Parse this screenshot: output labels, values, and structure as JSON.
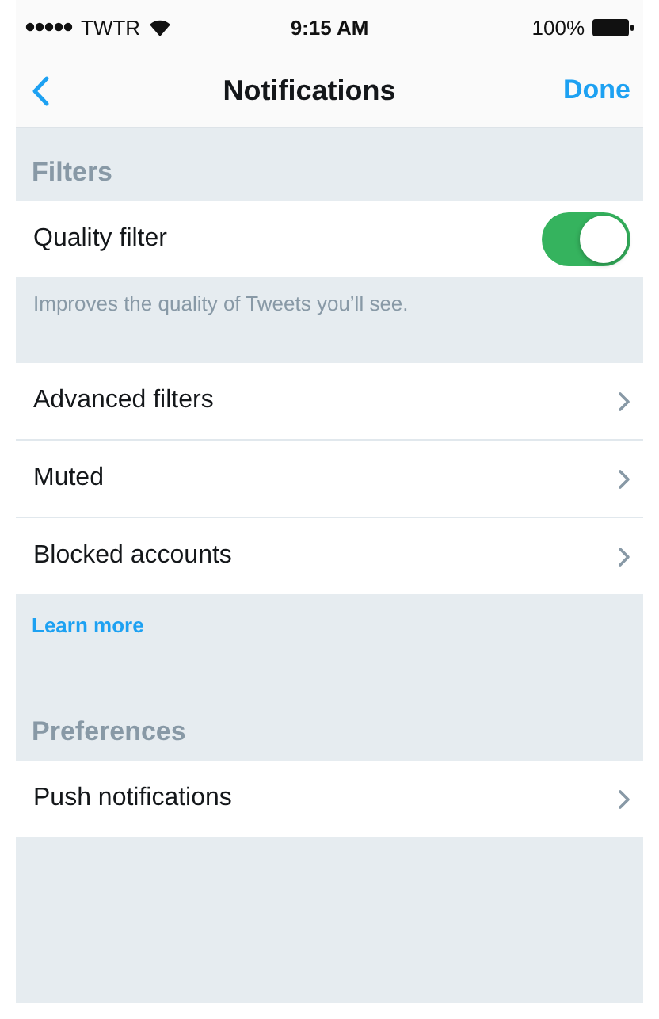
{
  "status_bar": {
    "carrier": "TWTR",
    "time": "9:15 AM",
    "battery": "100%"
  },
  "nav": {
    "title": "Notifications",
    "done": "Done"
  },
  "sections": [
    {
      "header": "Filters",
      "rows": [
        {
          "kind": "toggle",
          "label": "Quality filter",
          "on": true
        }
      ],
      "footer": {
        "kind": "note",
        "text": "Improves the quality of Tweets you’ll see."
      }
    },
    {
      "rows": [
        {
          "kind": "link",
          "label": "Advanced filters"
        },
        {
          "kind": "link",
          "label": "Muted"
        },
        {
          "kind": "link",
          "label": "Blocked accounts"
        }
      ],
      "footer": {
        "kind": "link",
        "text": "Learn more"
      }
    },
    {
      "header": "Preferences",
      "rows": [
        {
          "kind": "link",
          "label": "Push notifications"
        }
      ]
    }
  ]
}
